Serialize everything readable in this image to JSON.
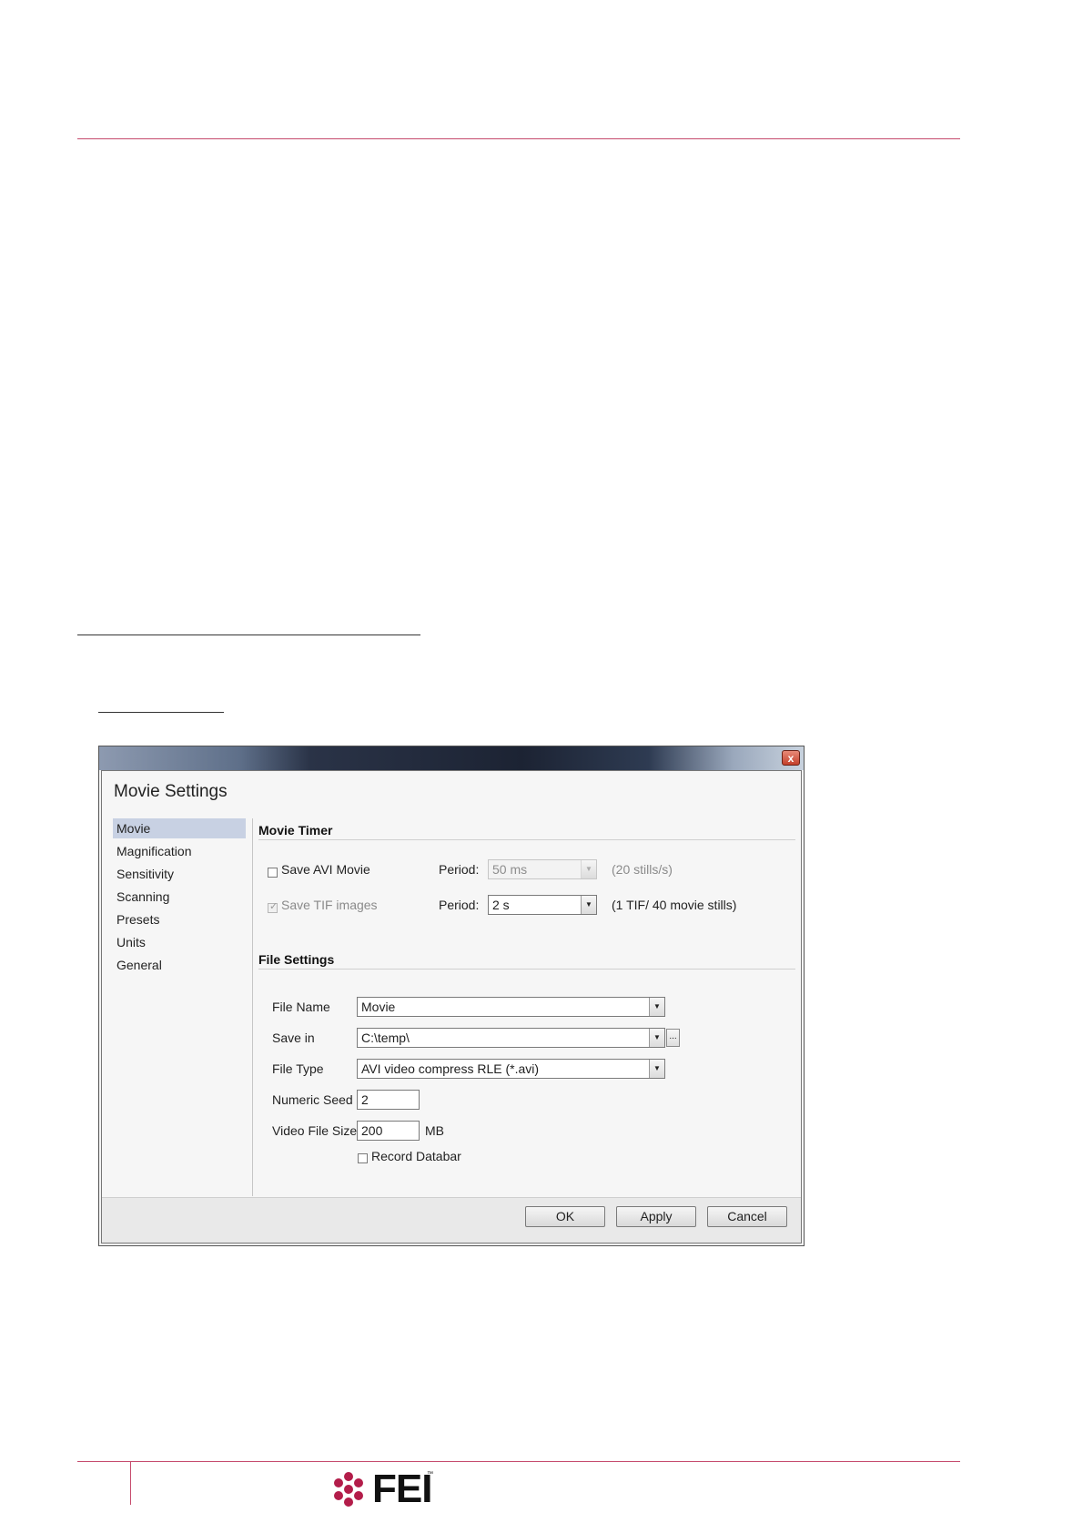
{
  "brand": {
    "name": "FEI",
    "trademark": "™",
    "accent": "#c64b6d"
  },
  "dialog": {
    "title": "Movie Settings",
    "close_label": "x",
    "nav_items": [
      "Movie",
      "Magnification",
      "Sensitivity",
      "Scanning",
      "Presets",
      "Units",
      "General"
    ],
    "active_nav": "Movie",
    "movie_timer": {
      "title": "Movie Timer",
      "save_avi": {
        "label": "Save AVI Movie",
        "checked": false,
        "enabled": true
      },
      "avi_period_label": "Period:",
      "avi_period_value": "50 ms",
      "avi_rate": "(20 stills/s)",
      "save_tif": {
        "label": "Save TIF images",
        "checked": true,
        "enabled": false
      },
      "tif_period_label": "Period:",
      "tif_period_value": "2 s",
      "tif_rate": "(1 TIF/ 40 movie stills)"
    },
    "file_settings": {
      "title": "File Settings",
      "file_name_label": "File Name",
      "file_name_value": "Movie",
      "save_in_label": "Save in",
      "save_in_value": "C:\\temp\\",
      "browse_label": "...",
      "file_type_label": "File Type",
      "file_type_value": "AVI video compress RLE (*.avi)",
      "numeric_seed_label": "Numeric Seed",
      "numeric_seed_value": "2",
      "video_file_size_label": "Video File Size",
      "video_file_size_value": "200",
      "video_file_size_unit": "MB",
      "record_databar": {
        "label": "Record Databar",
        "checked": false
      }
    },
    "buttons": {
      "ok": "OK",
      "apply": "Apply",
      "cancel": "Cancel"
    }
  }
}
